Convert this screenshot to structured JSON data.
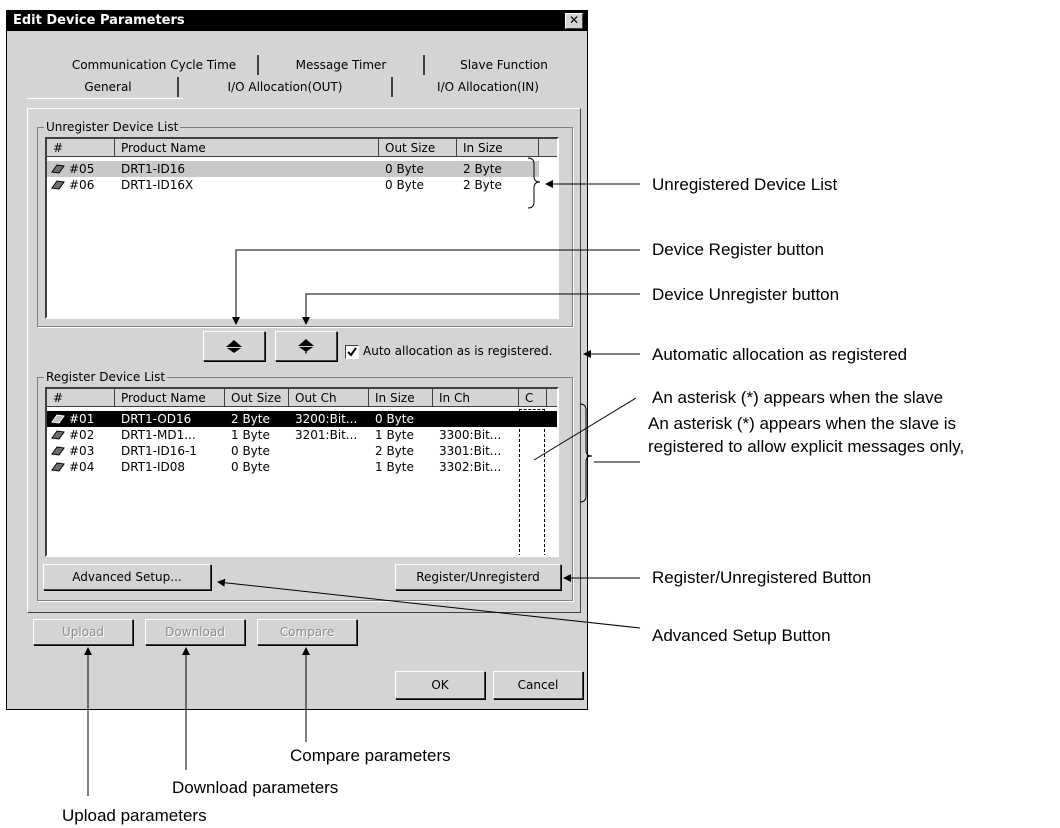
{
  "window": {
    "title": "Edit Device Parameters",
    "close_glyph": "✕"
  },
  "tabs_top": [
    "Communication Cycle Time",
    "Message Timer",
    "Slave Function"
  ],
  "tabs_bottom": [
    "General",
    "I/O Allocation(OUT)",
    "I/O Allocation(IN)"
  ],
  "unregister": {
    "legend": "Unregister Device List",
    "headers": [
      "#",
      "Product Name",
      "Out Size",
      "In Size"
    ],
    "rows": [
      [
        "#05",
        "DRT1-ID16",
        "0 Byte",
        "2 Byte"
      ],
      [
        "#06",
        "DRT1-ID16X",
        "0 Byte",
        "2 Byte"
      ]
    ]
  },
  "auto_alloc_label": "Auto allocation as is registered.",
  "register": {
    "legend": "Register Device List",
    "headers": [
      "#",
      "Product Name",
      "Out Size",
      "Out Ch",
      "In Size",
      "In Ch",
      "C"
    ],
    "rows": [
      [
        "#01",
        "DRT1-OD16",
        "2 Byte",
        "3200:Bit...",
        "0 Byte",
        "",
        ""
      ],
      [
        "#02",
        "DRT1-MD1...",
        "1 Byte",
        "3201:Bit...",
        "1 Byte",
        "3300:Bit...",
        ""
      ],
      [
        "#03",
        "DRT1-ID16-1",
        "0 Byte",
        "",
        "2 Byte",
        "3301:Bit...",
        ""
      ],
      [
        "#04",
        "DRT1-ID08",
        "0 Byte",
        "",
        "1 Byte",
        "3302:Bit...",
        ""
      ]
    ]
  },
  "buttons": {
    "advanced": "Advanced Setup...",
    "register_unregistered": "Register/Unregisterd",
    "upload": "Upload",
    "download": "Download",
    "compare": "Compare",
    "ok": "OK",
    "cancel": "Cancel"
  },
  "annotations": {
    "unregistered_list": "Unregistered Device List",
    "device_register": "Device Register button",
    "device_unregister": "Device Unregister button",
    "auto_allocation": "Automatic allocation as registered",
    "asterisk_1": "An asterisk (*) appears when the slave",
    "asterisk_2": "An asterisk (*) appears when the slave is",
    "asterisk_3": "registered to allow explicit messages only,",
    "register_unregistered_btn": "Register/Unregistered Button",
    "advanced_setup_btn": "Advanced Setup Button",
    "compare_params": "Compare parameters",
    "download_params": "Download parameters",
    "upload_params": "Upload parameters"
  }
}
